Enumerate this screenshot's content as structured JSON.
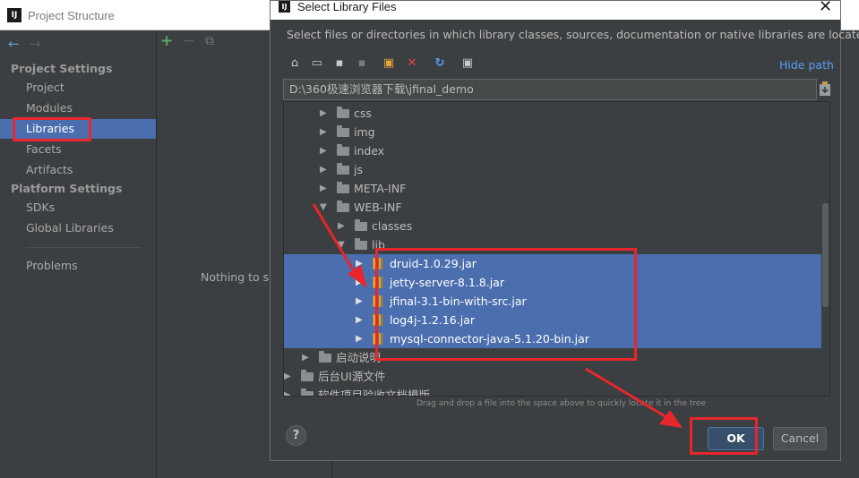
{
  "project_structure": {
    "title": "Project Structure",
    "app_icon": "IJ",
    "back_icon": "←",
    "forward_icon": "→",
    "groups": {
      "project_settings": "Project Settings",
      "platform_settings": "Platform Settings"
    },
    "items": {
      "project": "Project",
      "modules": "Modules",
      "libraries": "Libraries",
      "facets": "Facets",
      "artifacts": "Artifacts",
      "sdks": "SDKs",
      "global_libraries": "Global Libraries",
      "problems": "Problems"
    },
    "toolbar": {
      "add": "+",
      "remove": "−",
      "copy": "⧉"
    },
    "main_empty": "Nothing to sh"
  },
  "dialog": {
    "title": "Select Library Files",
    "app_icon": "IJ",
    "close": "✕",
    "description": "Select files or directories in which library classes, sources, documentation or native libraries are located",
    "hide_path": "Hide path",
    "path": "D:\\360极速浏览器下载\\jfinal_demo",
    "tools": {
      "home": "⌂",
      "desktop": "▭",
      "project": "▪",
      "module": "▪",
      "new_folder": "▣",
      "delete": "✕",
      "refresh": "↻",
      "show_hidden": "▣"
    },
    "tree": [
      {
        "label": "css",
        "expanded": "▶"
      },
      {
        "label": "img",
        "expanded": "▶"
      },
      {
        "label": "index",
        "expanded": "▶"
      },
      {
        "label": "js",
        "expanded": "▶"
      },
      {
        "label": "META-INF",
        "expanded": "▶"
      },
      {
        "label": "WEB-INF",
        "expanded": "▼"
      },
      {
        "label": "classes",
        "expanded": "▶"
      },
      {
        "label": "lib",
        "expanded": "▼"
      },
      {
        "label": "druid-1.0.29.jar",
        "expanded": "▶"
      },
      {
        "label": "jetty-server-8.1.8.jar",
        "expanded": "▶"
      },
      {
        "label": "jfinal-3.1-bin-with-src.jar",
        "expanded": "▶"
      },
      {
        "label": "log4j-1.2.16.jar",
        "expanded": "▶"
      },
      {
        "label": "mysql-connector-java-5.1.20-bin.jar",
        "expanded": "▶"
      },
      {
        "label": "启动说明",
        "expanded": "▶"
      },
      {
        "label": "后台UI源文件",
        "expanded": "▶"
      },
      {
        "label": "软件项目验收文档模版",
        "expanded": "▶"
      }
    ],
    "drag_hint": "Drag and drop a file into the space above to quickly locate it in the tree",
    "help": "?",
    "ok": "OK",
    "cancel": "Cancel"
  },
  "colors": {
    "background": "#3c3f41",
    "selection": "#4b6eaf",
    "link": "#589df6",
    "annotation_red": "#e8262b",
    "add_green": "#59a869"
  }
}
